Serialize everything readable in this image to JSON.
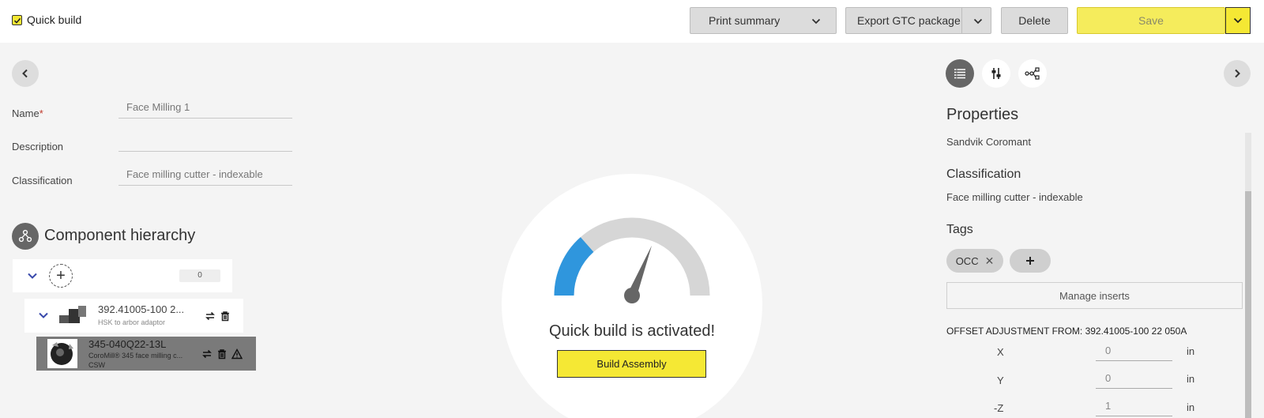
{
  "topbar": {
    "quick_build_label": "Quick build",
    "quick_build_checked": true,
    "print_summary": "Print summary",
    "export_gtc": "Export GTC package",
    "delete": "Delete",
    "save": "Save"
  },
  "form": {
    "name_label": "Name",
    "name_required_mark": "*",
    "name_value": "Face Milling 1",
    "description_label": "Description",
    "description_value": "",
    "classification_label": "Classification",
    "classification_value": "Face milling cutter - indexable"
  },
  "hierarchy": {
    "title": "Component hierarchy",
    "root_count": "0",
    "items": [
      {
        "title": "392.41005-100 2...",
        "subtitle": "HSK to arbor adaptor"
      },
      {
        "title": "345-040Q22-13L",
        "subtitle": "CoroMill® 345 face milling c...",
        "subtitle2": "CSW"
      }
    ]
  },
  "center": {
    "status": "Quick build is activated!",
    "build_button": "Build Assembly",
    "gauge_level": 0.27,
    "colors": {
      "gauge_fill": "#2f96dd",
      "gauge_track": "#d6d6d6",
      "needle": "#666666"
    }
  },
  "properties": {
    "heading": "Properties",
    "brand": "Sandvik Coromant",
    "classification_heading": "Classification",
    "classification_value": "Face milling cutter - indexable",
    "tags_heading": "Tags",
    "tags": [
      "OCC"
    ],
    "manage_inserts": "Manage inserts",
    "offset_heading": "OFFSET ADJUSTMENT FROM: 392.41005-100 22 050A",
    "offsets": [
      {
        "axis": "X",
        "value": "0",
        "unit": "in"
      },
      {
        "axis": "Y",
        "value": "0",
        "unit": "in"
      },
      {
        "axis": "-Z",
        "value": "1",
        "unit": "in"
      }
    ]
  },
  "colors": {
    "accent_yellow": "#f5e834",
    "active_tab": "#666666"
  }
}
